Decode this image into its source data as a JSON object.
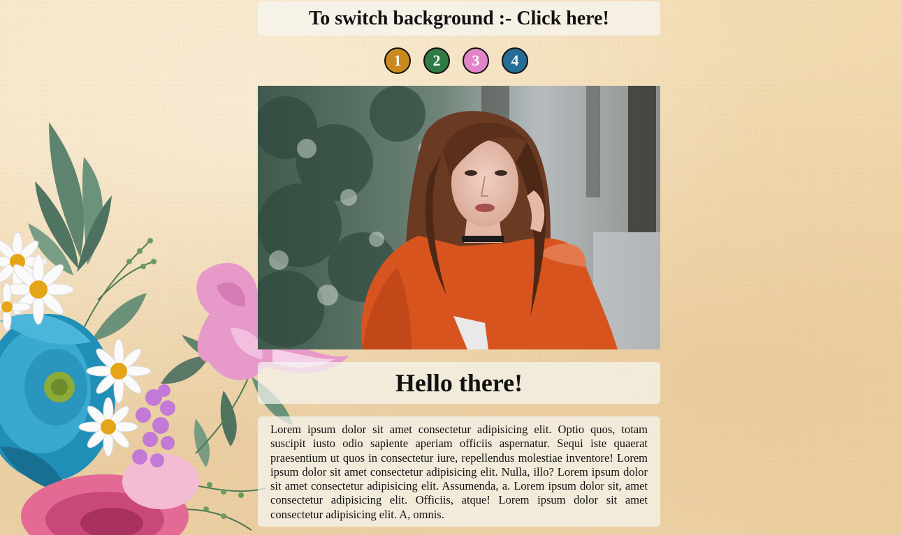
{
  "switcher": {
    "label": "To switch background :- Click here!",
    "options": [
      {
        "label": "1",
        "color": "#c8891f"
      },
      {
        "label": "2",
        "color": "#2f7a45"
      },
      {
        "label": "3",
        "color": "#e185c8"
      },
      {
        "label": "4",
        "color": "#256d95"
      }
    ]
  },
  "photo": {
    "icon": "portrait-photo-icon"
  },
  "content": {
    "heading": "Hello there!",
    "paragraph": "Lorem ipsum dolor sit amet consectetur adipisicing elit. Optio quos, totam suscipit iusto odio sapiente aperiam officiis aspernatur. Sequi iste quaerat praesentium ut quos in consectetur iure, repellendus molestiae inventore! Lorem ipsum dolor sit amet consectetur adipisicing elit. Nulla, illo? Lorem ipsum dolor sit amet consectetur adipisicing elit. Assumenda, a. Lorem ipsum dolor sit, amet consectetur adipisicing elit. Officiis, atque! Lorem ipsum dolor sit amet consectetur adipisicing elit. A, omnis."
  },
  "decoration": {
    "icon": "floral-bouquet-icon"
  }
}
